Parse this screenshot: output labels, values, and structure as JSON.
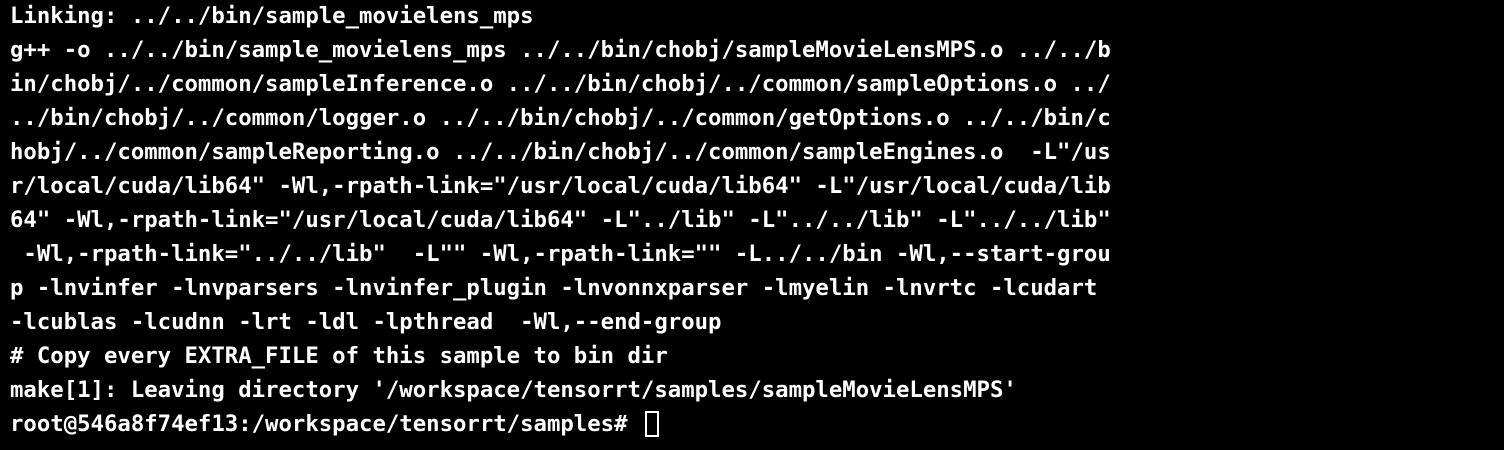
{
  "terminal": {
    "background": "#000000",
    "foreground": "#ffffff",
    "lines": [
      "Linking: ../../bin/sample_movielens_mps",
      "g++ -o ../../bin/sample_movielens_mps ../../bin/chobj/sampleMovieLensMPS.o ../../b",
      "in/chobj/../common/sampleInference.o ../../bin/chobj/../common/sampleOptions.o ../",
      "../bin/chobj/../common/logger.o ../../bin/chobj/../common/getOptions.o ../../bin/c",
      "hobj/../common/sampleReporting.o ../../bin/chobj/../common/sampleEngines.o  -L\"/us",
      "r/local/cuda/lib64\" -Wl,-rpath-link=\"/usr/local/cuda/lib64\" -L\"/usr/local/cuda/lib",
      "64\" -Wl,-rpath-link=\"/usr/local/cuda/lib64\" -L\"../lib\" -L\"../../lib\" -L\"../../lib\"",
      " -Wl,-rpath-link=\"../../lib\"  -L\"\" -Wl,-rpath-link=\"\" -L../../bin -Wl,--start-grou",
      "p -lnvinfer -lnvparsers -lnvinfer_plugin -lnvonnxparser -lmyelin -lnvrtc -lcudart",
      "-lcublas -lcudnn -lrt -ldl -lpthread  -Wl,--end-group",
      "# Copy every EXTRA_FILE of this sample to bin dir",
      "make[1]: Leaving directory '/workspace/tensorrt/samples/sampleMovieLensMPS'"
    ],
    "prompt": "root@546a8f74ef13:/workspace/tensorrt/samples# ",
    "cursor_icon": "block-cursor-outline"
  }
}
